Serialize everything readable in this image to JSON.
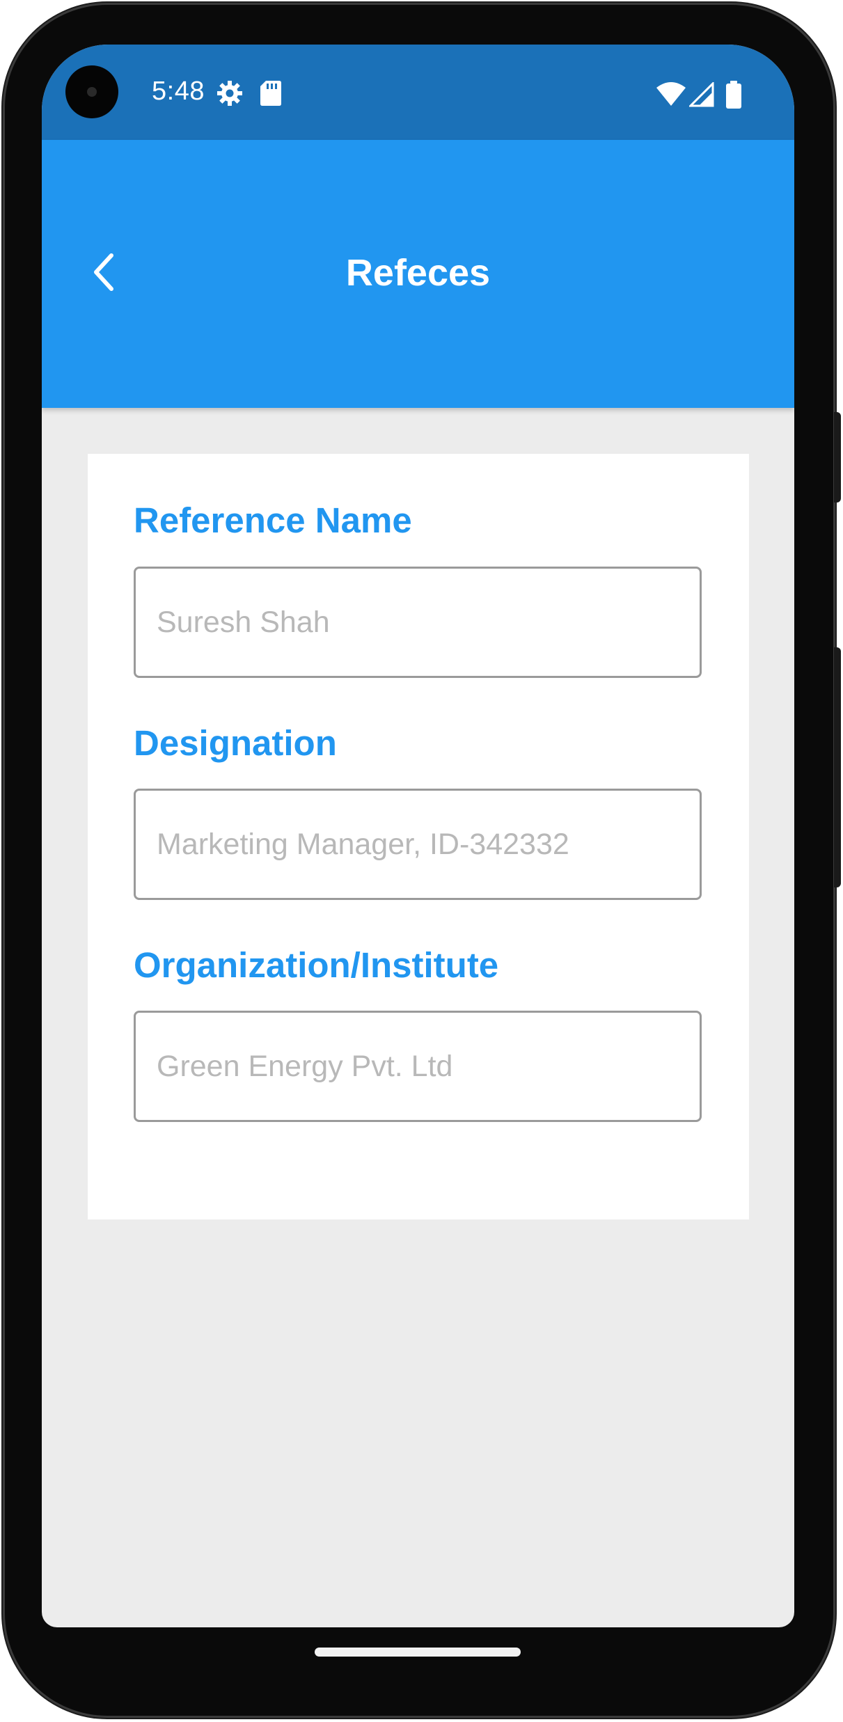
{
  "status_bar": {
    "time": "5:48",
    "icons_left": [
      "settings-gear-icon",
      "sd-card-icon"
    ],
    "icons_right": [
      "wifi-icon",
      "cell-signal-icon",
      "battery-icon"
    ],
    "color": "#1b71b8"
  },
  "app_bar": {
    "title": "Refeces",
    "back_icon": "chevron-left-icon",
    "color": "#2196f0"
  },
  "form": {
    "fields": [
      {
        "label": "Reference Name",
        "placeholder": "Suresh Shah",
        "value": ""
      },
      {
        "label": "Designation",
        "placeholder": "Marketing Manager, ID-342332",
        "value": ""
      },
      {
        "label": "Organization/Institute",
        "placeholder": "Green Energy Pvt. Ltd",
        "value": ""
      }
    ],
    "label_color": "#2196f0"
  }
}
